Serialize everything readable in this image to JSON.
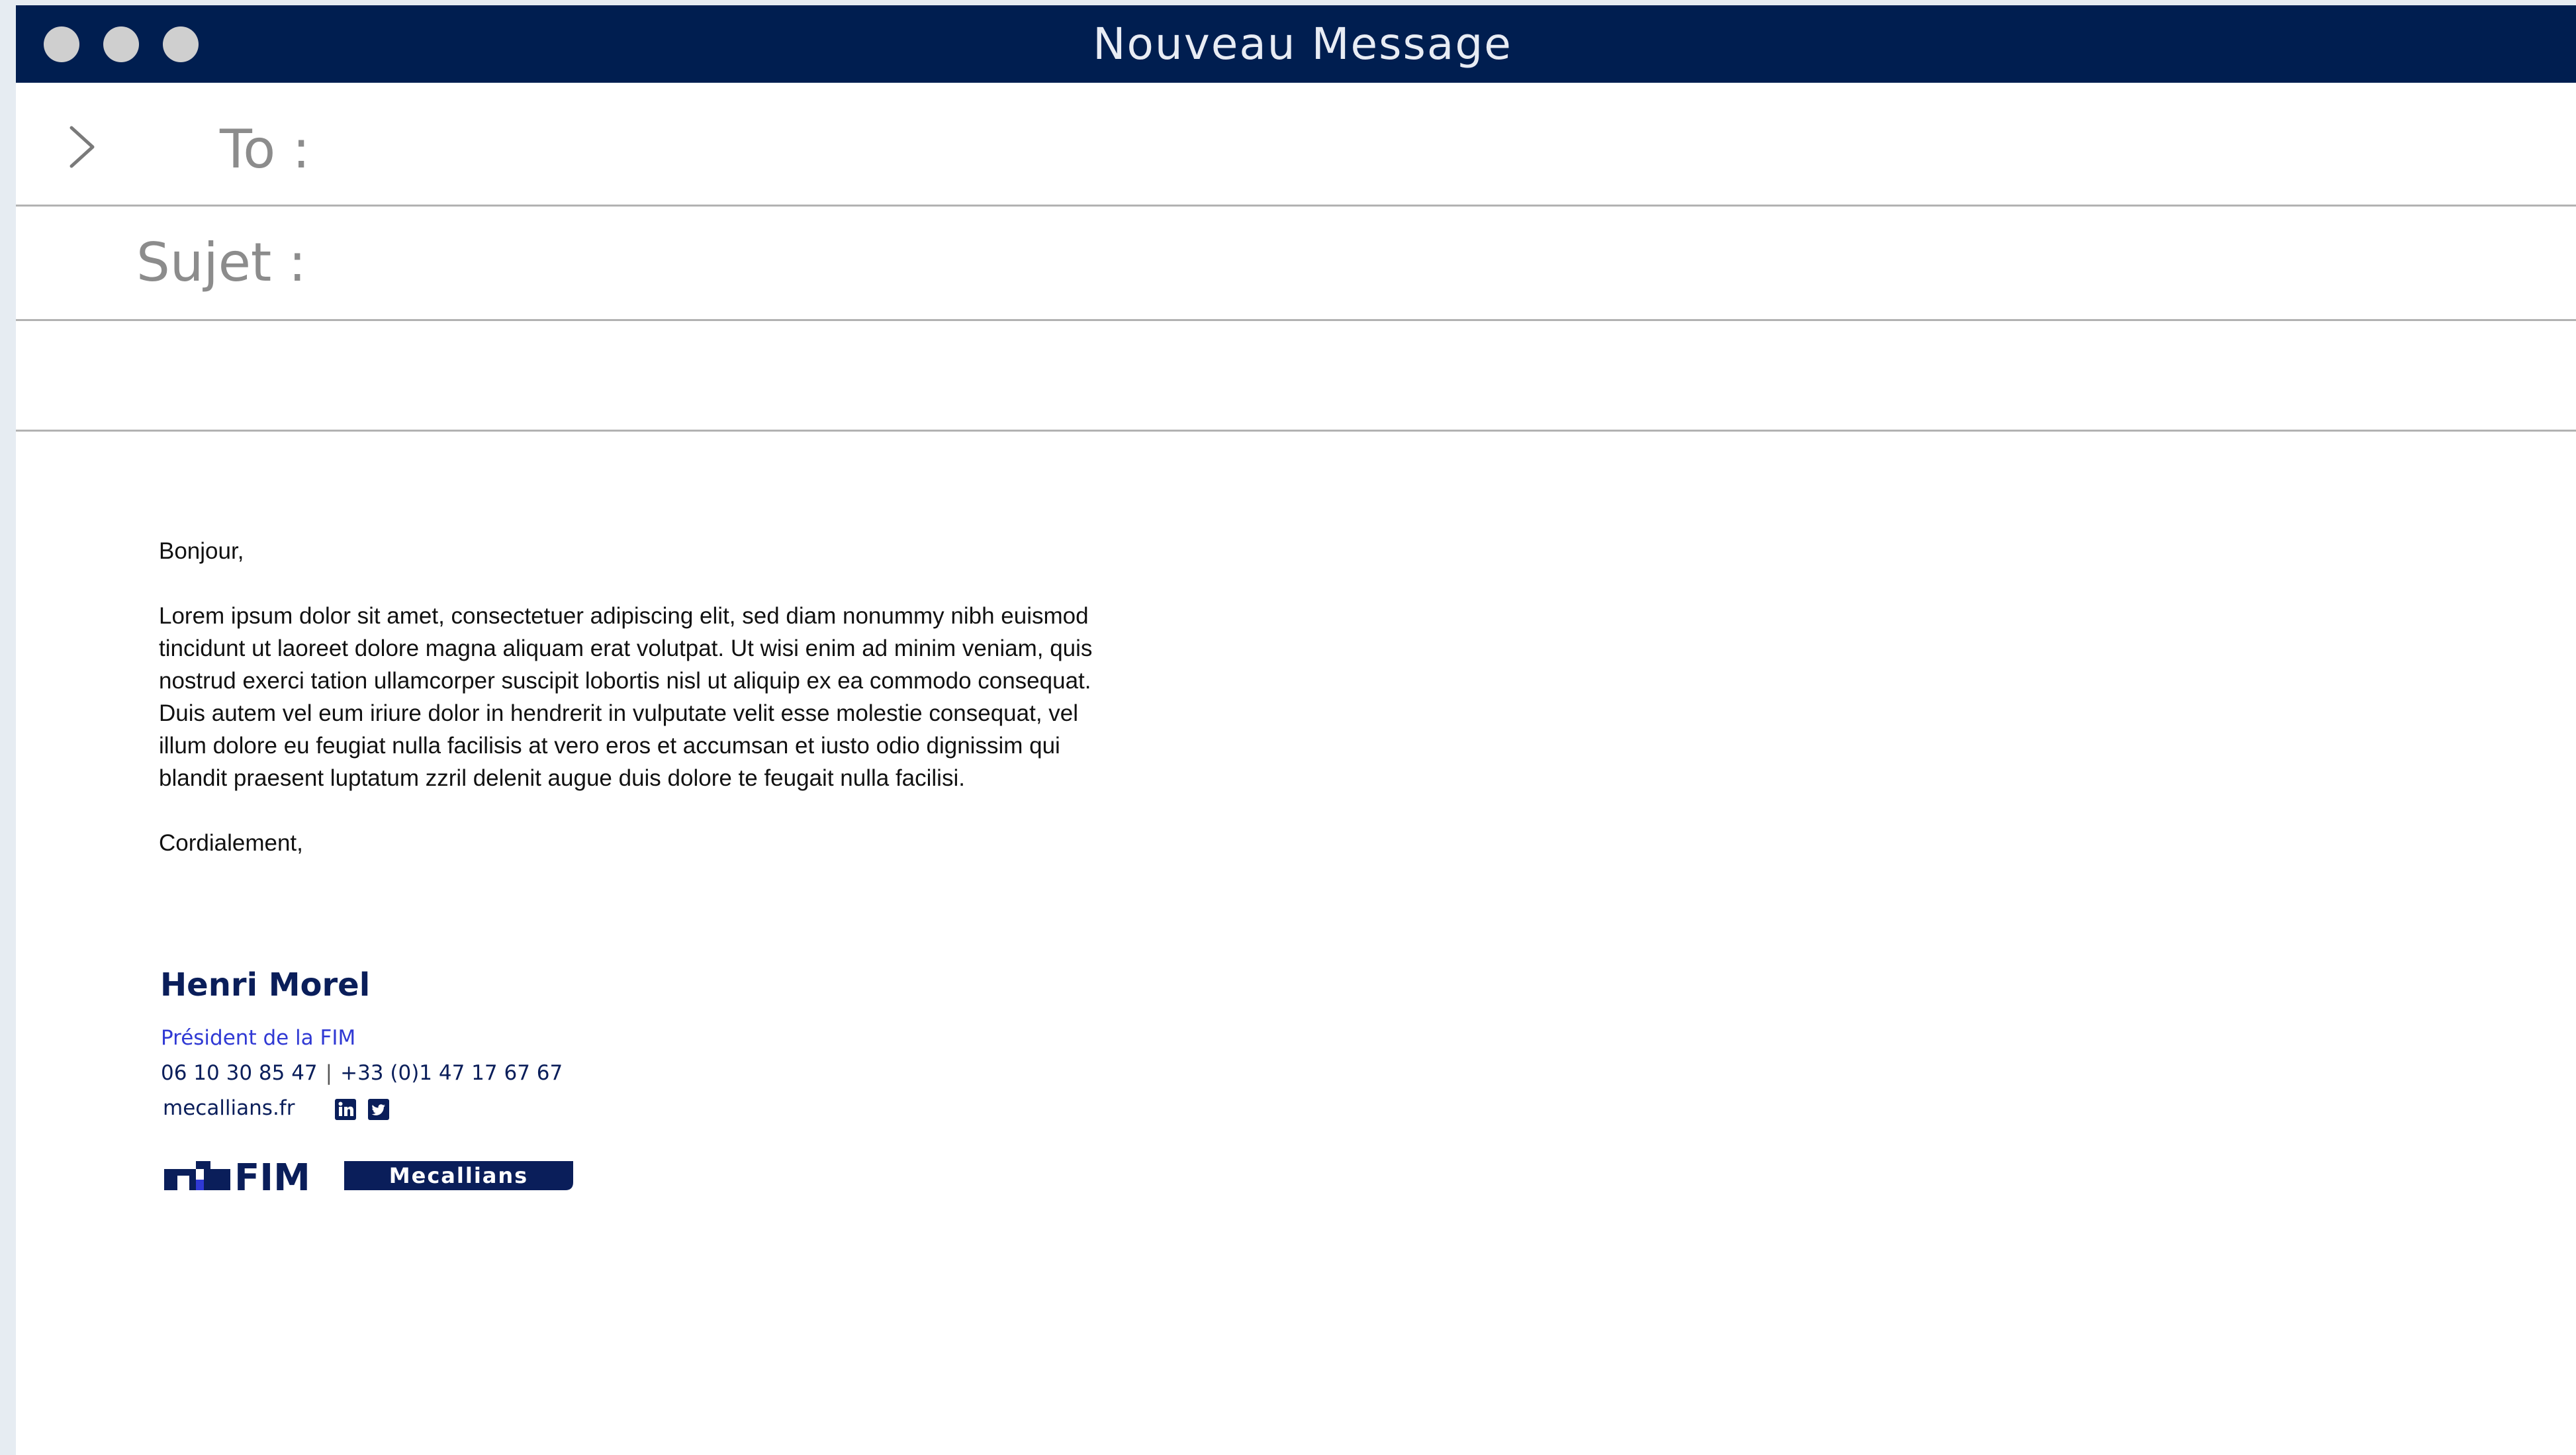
{
  "window": {
    "title": "Nouveau Message",
    "controls": [
      "close",
      "minimize",
      "maximize"
    ]
  },
  "compose": {
    "to_label": "To :",
    "to_value": "",
    "subject_label": "Sujet :",
    "subject_value": "",
    "extra_value": ""
  },
  "message": {
    "greeting": "Bonjour,",
    "body": "Lorem ipsum dolor sit amet, consectetuer adipiscing elit, sed diam nonummy nibh euismod tincidunt ut laoreet dolore magna aliquam erat volutpat. Ut wisi enim ad minim veniam, quis nostrud exerci tation ullamcorper suscipit lobortis nisl ut aliquip ex ea commodo consequat. Duis autem vel eum iriure dolor in hendrerit in vulputate velit esse molestie consequat, vel illum dolore eu feugiat nulla facilisis at vero eros et accumsan et iusto odio dignissim qui blandit praesent luptatum zzril delenit augue duis dolore te feugait nulla facilisi.",
    "closing": "Cordialement,"
  },
  "signature": {
    "name": "Henri Morel",
    "role": "Président de la FIM",
    "mobile": "06 10 30 85 47",
    "phone_separator": "|",
    "phone": "+33 (0)1 47 17 67 67",
    "website": "mecallians.fr",
    "social_icons": [
      "linkedin-icon",
      "twitter-icon"
    ],
    "logo_fim": "FIM",
    "logo_mecallians": "Mecallians"
  },
  "colors": {
    "titlebar": "#001e50",
    "window_control": "#cfcfcf",
    "brand_navy": "#0a1e5a",
    "brand_blue": "#3039d4",
    "divider": "#b2b2b2",
    "label_gray": "#8c8c8c"
  },
  "icons": {
    "recipients_toggle": "chevron-right-icon"
  }
}
